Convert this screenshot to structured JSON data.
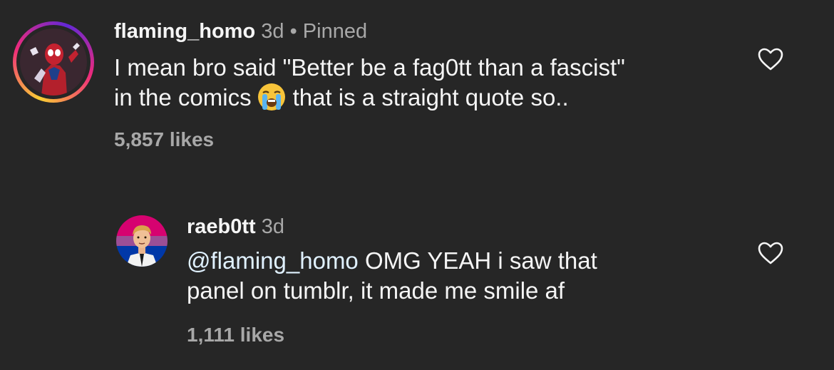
{
  "comments": [
    {
      "username": "flaming_homo",
      "time": "3d",
      "separator": "•",
      "pinned_label": "Pinned",
      "text_line1": "I mean bro said \"Better be a fag0tt than a fascist\"",
      "text_line2_a": "in the comics",
      "emoji": "loudly-crying-face",
      "text_line2_b": "that is a straight quote so..",
      "likes": "5,857 likes",
      "avatar": "spider-man-avatar",
      "story_ring": true
    },
    {
      "username": "raeb0tt",
      "time": "3d",
      "mention": "@flaming_homo",
      "text_line1_rest": " OMG YEAH i saw that",
      "text_line2": "panel on tumblr, it made me smile af",
      "likes": "1,111 likes",
      "avatar": "bi-flag-cartoon-avatar"
    }
  ],
  "colors": {
    "background": "#262626",
    "primary_text": "#f5f5f5",
    "secondary_text": "#a8a8a8",
    "mention": "#e0f1ff",
    "bi_flag": [
      "#d60270",
      "#9b4f96",
      "#0038a8"
    ]
  }
}
